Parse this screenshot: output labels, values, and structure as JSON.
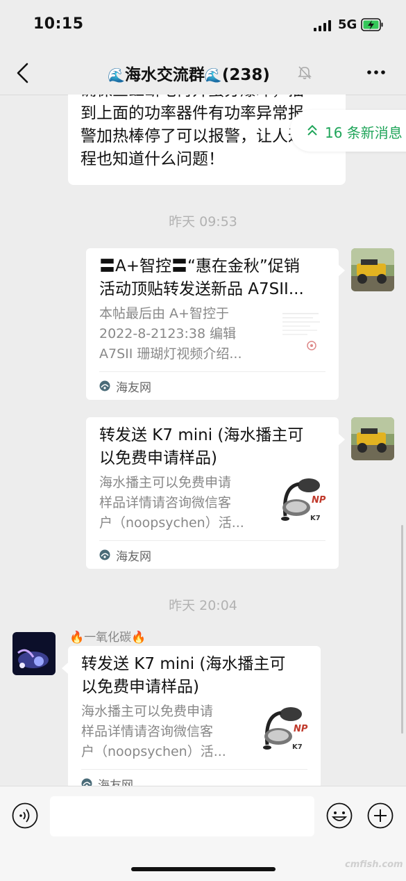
{
  "status_bar": {
    "time": "10:15",
    "network": "5G"
  },
  "header": {
    "title_prefix_emoji": "🌊",
    "title_text": "海水交流群",
    "title_suffix_emoji": "🌊",
    "member_count": "(238)"
  },
  "new_messages": {
    "label": "16 条新消息"
  },
  "messages": {
    "prev_text_lines": [
      "确保鱼缸断电再开蛋分爆冲，插",
      "到上面的功率器件有功率异常报",
      "警加热棒停了可以报警，让人过",
      "程也知道什么问题！"
    ],
    "timestamp1": "昨天 09:53",
    "card1": {
      "title_line1": "〓A+智控〓“惠在金秋”促销",
      "title_line2": "活动顶贴转发送新品 A7SII...",
      "desc_line1": "本帖最后由 A+智控于",
      "desc_line2": "2022-8-2123:38 编辑",
      "desc_line3": "A7SII 珊瑚灯视频介绍...",
      "source": "海友网"
    },
    "card2": {
      "title_line1": "转发送 K7 mini (海水播主可",
      "title_line2": "以免费申请样品)",
      "desc_line1": "海水播主可以免费申请",
      "desc_line2": "样品详情请咨询微信客",
      "desc_line3": "户（noopsychen）活...",
      "source": "海友网"
    },
    "timestamp2": "昨天 20:04",
    "sender": {
      "fire_left": "🔥",
      "name": "一氧化碳",
      "fire_right": "🔥"
    },
    "card3": {
      "title_line1": "转发送 K7 mini (海水播主可",
      "title_line2": "以免费申请样品)",
      "desc_line1": "海水播主可以免费申请",
      "desc_line2": "样品详情请咨询微信客",
      "desc_line3": "户（noopsychen）活...",
      "source": "海友网"
    }
  },
  "thumb": {
    "brand": "NP",
    "model": "K7"
  },
  "watermark": "cmfish.com",
  "colors": {
    "background": "#ededed",
    "bubble": "#ffffff",
    "accent_green": "#20a55a",
    "battery_green": "#34c759"
  }
}
